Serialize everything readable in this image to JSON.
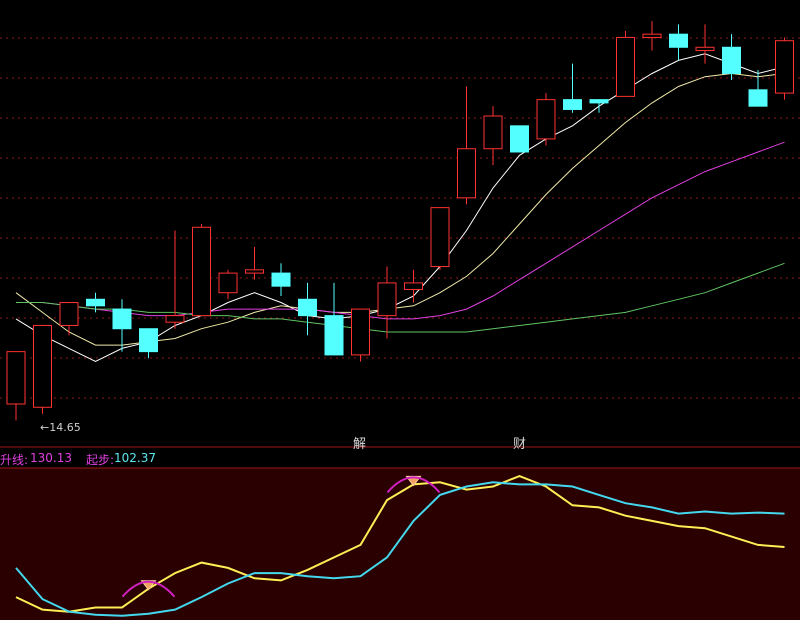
{
  "chart_data": [
    {
      "type": "candlestick",
      "panel": "main",
      "candles": [
        {
          "o": 14.71,
          "h": 14.87,
          "l": 14.66,
          "c": 14.87
        },
        {
          "o": 14.7,
          "h": 14.95,
          "l": 14.68,
          "c": 14.95
        },
        {
          "o": 14.95,
          "h": 15.0,
          "l": 14.92,
          "c": 15.02
        },
        {
          "o": 15.03,
          "h": 15.05,
          "l": 14.99,
          "c": 15.01
        },
        {
          "o": 15.0,
          "h": 15.03,
          "l": 14.87,
          "c": 14.94
        },
        {
          "o": 14.94,
          "h": 14.94,
          "l": 14.85,
          "c": 14.87
        },
        {
          "o": 14.96,
          "h": 15.24,
          "l": 14.94,
          "c": 14.98
        },
        {
          "o": 14.98,
          "h": 15.26,
          "l": 14.98,
          "c": 15.25
        },
        {
          "o": 15.05,
          "h": 15.12,
          "l": 15.03,
          "c": 15.11
        },
        {
          "o": 15.11,
          "h": 15.19,
          "l": 15.09,
          "c": 15.12
        },
        {
          "o": 15.11,
          "h": 15.14,
          "l": 15.04,
          "c": 15.07
        },
        {
          "o": 15.03,
          "h": 15.08,
          "l": 14.92,
          "c": 14.98
        },
        {
          "o": 14.98,
          "h": 15.08,
          "l": 14.86,
          "c": 14.86
        },
        {
          "o": 14.86,
          "h": 15.0,
          "l": 14.84,
          "c": 15.0
        },
        {
          "o": 14.98,
          "h": 15.13,
          "l": 14.91,
          "c": 15.08
        },
        {
          "o": 15.06,
          "h": 15.12,
          "l": 15.02,
          "c": 15.08
        },
        {
          "o": 15.13,
          "h": 15.31,
          "l": 15.12,
          "c": 15.31
        },
        {
          "o": 15.34,
          "h": 15.68,
          "l": 15.32,
          "c": 15.49
        },
        {
          "o": 15.49,
          "h": 15.62,
          "l": 15.44,
          "c": 15.59
        },
        {
          "o": 15.56,
          "h": 15.51,
          "l": 15.48,
          "c": 15.48
        },
        {
          "o": 15.52,
          "h": 15.66,
          "l": 15.5,
          "c": 15.64
        },
        {
          "o": 15.64,
          "h": 15.75,
          "l": 15.6,
          "c": 15.61
        },
        {
          "o": 15.64,
          "h": 15.63,
          "l": 15.6,
          "c": 15.63
        },
        {
          "o": 15.65,
          "h": 15.85,
          "l": 15.65,
          "c": 15.83
        },
        {
          "o": 15.83,
          "h": 15.88,
          "l": 15.79,
          "c": 15.84
        },
        {
          "o": 15.84,
          "h": 15.87,
          "l": 15.76,
          "c": 15.8
        },
        {
          "o": 15.79,
          "h": 15.87,
          "l": 15.75,
          "c": 15.8
        },
        {
          "o": 15.8,
          "h": 15.84,
          "l": 15.7,
          "c": 15.72
        },
        {
          "o": 15.67,
          "h": 15.73,
          "l": 15.62,
          "c": 15.62
        },
        {
          "o": 15.66,
          "h": 15.83,
          "l": 15.64,
          "c": 15.82
        }
      ],
      "ma": [
        {
          "color": "#ffffff",
          "values": [
            14.97,
            14.92,
            14.88,
            14.84,
            14.88,
            14.9,
            14.95,
            14.98,
            15.02,
            15.05,
            15.02,
            14.98,
            14.97,
            14.98,
            15.0,
            15.04,
            15.13,
            15.24,
            15.37,
            15.47,
            15.52,
            15.56,
            15.62,
            15.67,
            15.72,
            15.76,
            15.78,
            15.75,
            15.72,
            15.74
          ]
        },
        {
          "color": "#f0eaa8",
          "values": [
            15.05,
            14.99,
            14.93,
            14.89,
            14.89,
            14.9,
            14.91,
            14.94,
            14.96,
            14.99,
            15.01,
            15.0,
            14.99,
            14.99,
            15.0,
            15.01,
            15.05,
            15.1,
            15.17,
            15.26,
            15.35,
            15.43,
            15.5,
            15.57,
            15.63,
            15.68,
            15.71,
            15.72,
            15.71,
            15.72
          ]
        },
        {
          "color": "#e040e0",
          "values": [
            15.02,
            15.02,
            15.01,
            15.0,
            14.99,
            14.98,
            14.98,
            14.99,
            15.0,
            15.0,
            15.0,
            15.0,
            14.99,
            14.98,
            14.97,
            14.97,
            14.98,
            15.0,
            15.04,
            15.09,
            15.14,
            15.19,
            15.24,
            15.29,
            15.34,
            15.38,
            15.42,
            15.45,
            15.48,
            15.51
          ]
        },
        {
          "color": "#5fc463",
          "values": [
            15.02,
            15.02,
            15.01,
            15.0,
            15.0,
            14.99,
            14.99,
            14.98,
            14.98,
            14.97,
            14.97,
            14.96,
            14.95,
            14.94,
            14.93,
            14.93,
            14.93,
            14.93,
            14.94,
            14.95,
            14.96,
            14.97,
            14.98,
            14.99,
            15.01,
            15.03,
            15.05,
            15.08,
            15.11,
            15.14
          ]
        }
      ],
      "low_annotation": "14.65",
      "markers": [
        "解",
        "财"
      ]
    },
    {
      "type": "line",
      "panel": "indicator",
      "labels": [
        "升线:",
        "起步:"
      ],
      "values_display": [
        "130.13",
        "102.37"
      ],
      "series": [
        {
          "color": "#ffee55",
          "values": [
            22,
            10,
            8,
            12,
            12,
            30,
            45,
            55,
            50,
            40,
            38,
            48,
            60,
            72,
            115,
            130,
            132,
            125,
            128,
            138,
            128,
            110,
            108,
            100,
            95,
            90,
            88,
            80,
            72,
            70
          ]
        },
        {
          "color": "#44d8ee",
          "values": [
            50,
            20,
            8,
            5,
            4,
            6,
            10,
            22,
            35,
            45,
            45,
            42,
            40,
            42,
            60,
            95,
            120,
            128,
            132,
            130,
            130,
            128,
            120,
            112,
            108,
            102,
            104,
            102,
            103,
            102
          ]
        }
      ],
      "signals": [
        {
          "i": 5,
          "label": "▼"
        },
        {
          "i": 15,
          "label": "▼"
        }
      ]
    }
  ]
}
